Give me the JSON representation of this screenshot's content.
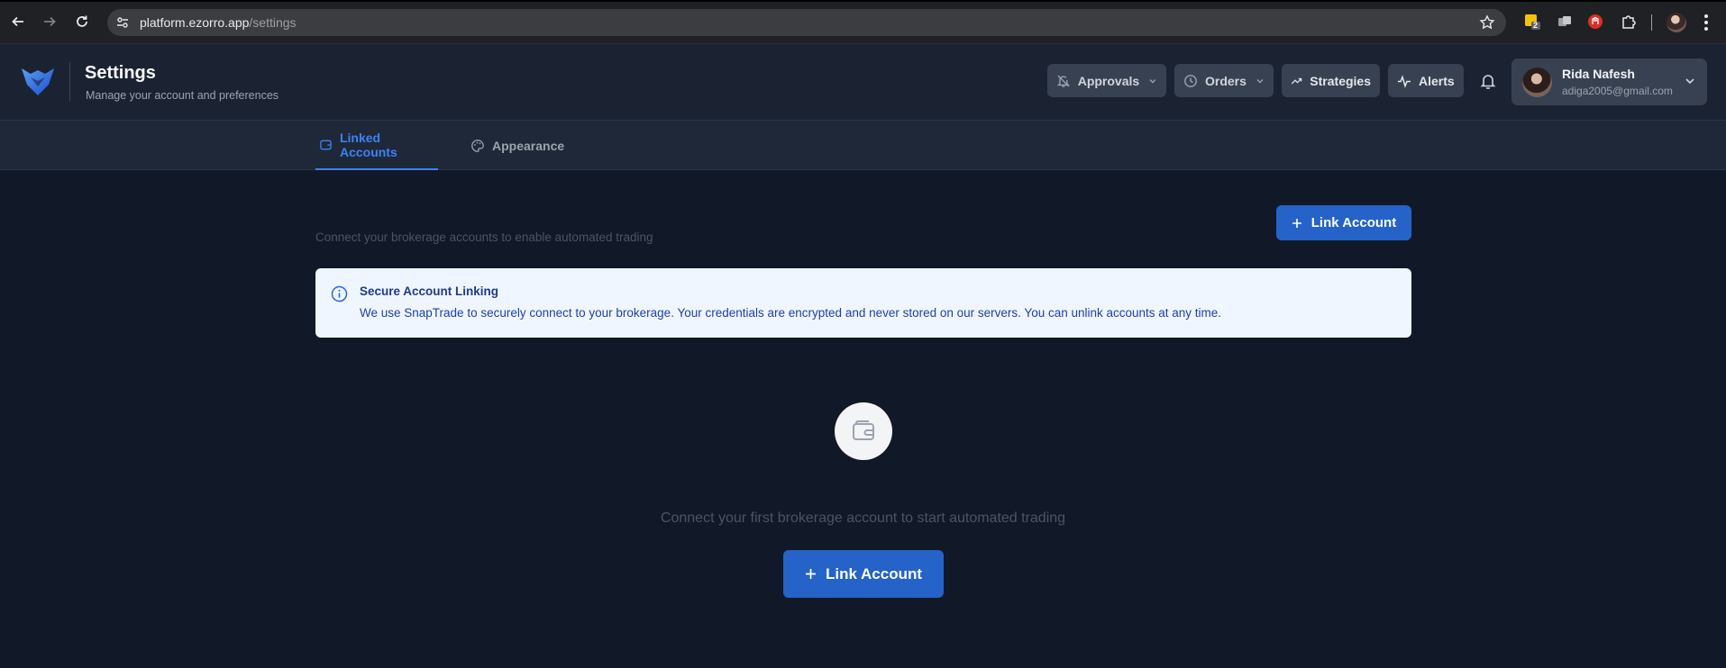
{
  "browser": {
    "url_host": "platform.ezorro.app",
    "url_path": "/settings",
    "extension_badge": "2"
  },
  "header": {
    "title": "Settings",
    "subtitle": "Manage your account and preferences",
    "nav": {
      "approvals": "Approvals",
      "orders": "Orders",
      "strategies": "Strategies",
      "alerts": "Alerts"
    },
    "user": {
      "name": "Rida Nafesh",
      "email": "adiga2005@gmail.com"
    }
  },
  "tabs": {
    "linked_accounts": "Linked Accounts",
    "appearance": "Appearance"
  },
  "main": {
    "description": "Connect your brokerage accounts to enable automated trading",
    "link_account_label": "Link Account",
    "info": {
      "title": "Secure Account Linking",
      "text": "We use SnapTrade to securely connect to your brokerage. Your credentials are encrypted and never stored on our servers. You can unlink accounts at any time."
    },
    "empty_state": {
      "text": "Connect your first brokerage account to start automated trading",
      "button_label": "Link Account"
    }
  },
  "colors": {
    "accent": "#3b82f6",
    "primary_button": "#2563c9",
    "background": "#111827",
    "header": "#1b2333"
  }
}
